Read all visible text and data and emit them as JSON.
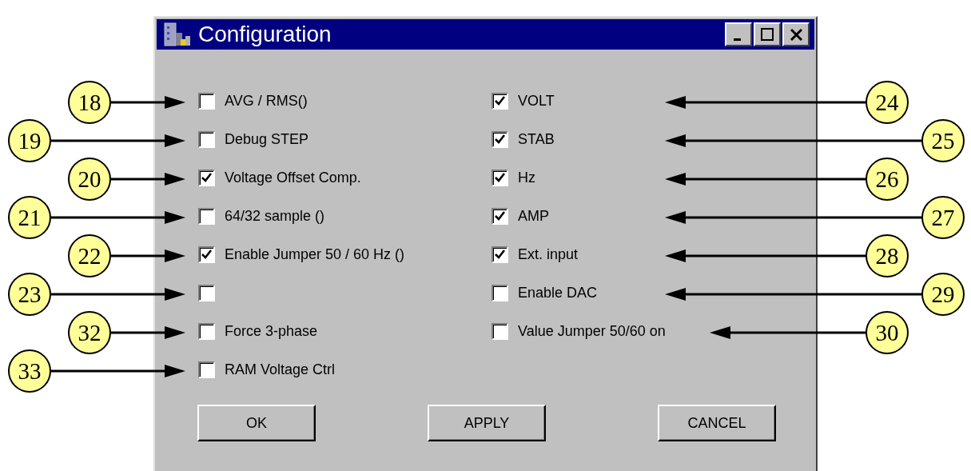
{
  "window": {
    "title": "Configuration"
  },
  "left_options": [
    {
      "callout": "18",
      "label": "AVG / RMS()",
      "checked": false
    },
    {
      "callout": "19",
      "label": "Debug STEP",
      "checked": false
    },
    {
      "callout": "20",
      "label": "Voltage Offset Comp.",
      "checked": true
    },
    {
      "callout": "21",
      "label": "64/32 sample ()",
      "checked": false
    },
    {
      "callout": "22",
      "label": "Enable Jumper 50 / 60 Hz ()",
      "checked": true
    },
    {
      "callout": "23",
      "checked": false
    },
    {
      "callout": "32",
      "label": "Force 3-phase",
      "checked": false
    },
    {
      "callout": "33",
      "label": "RAM Voltage Ctrl",
      "checked": false
    }
  ],
  "right_options": [
    {
      "callout": "24",
      "label": "VOLT",
      "checked": true
    },
    {
      "callout": "25",
      "label": "STAB",
      "checked": true
    },
    {
      "callout": "26",
      "label": "Hz",
      "checked": true
    },
    {
      "callout": "27",
      "label": "AMP",
      "checked": true
    },
    {
      "callout": "28",
      "label": "Ext. input",
      "checked": true
    },
    {
      "callout": "29",
      "label": "Enable DAC",
      "checked": false
    },
    {
      "callout": "30",
      "label": "Value Jumper 50/60 on",
      "checked": false
    }
  ],
  "buttons": [
    "OK",
    "APPLY",
    "CANCEL"
  ]
}
